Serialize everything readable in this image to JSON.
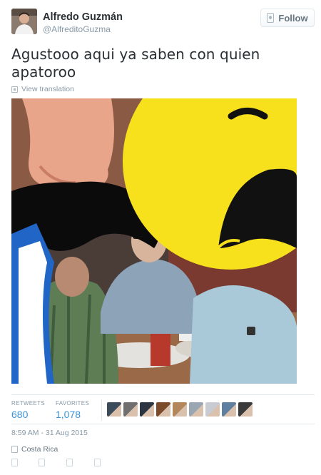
{
  "user": {
    "name": "Alfredo Guzmán",
    "handle": "@AlfreditoGuzma"
  },
  "follow": {
    "label": "Follow",
    "icon": "follow-user-icon"
  },
  "tweet": {
    "text": "Agustooo aqui ya saben con quien apatoroo",
    "translate_label": "View translation",
    "translate_icon": "translate-icon"
  },
  "stats": {
    "retweets_label": "RETWEETS",
    "retweets_value": "680",
    "favorites_label": "FAVORITES",
    "favorites_value": "1,078"
  },
  "favoriter_colors": [
    "#3d4a5a",
    "#6f6f6f",
    "#2c3440",
    "#7a4a2a",
    "#b3865b",
    "#9aa6b2",
    "#c8ccd2",
    "#5f7fa0",
    "#3a3a3a"
  ],
  "timestamp": "8:59 AM - 31 Aug 2015",
  "location": {
    "label": "Costa Rica",
    "icon": "location-pin-icon"
  },
  "actions": [
    "reply-icon",
    "retweet-icon",
    "favorite-icon",
    "more-icon"
  ],
  "colors": {
    "link": "#3b94d9",
    "meta": "#8899a6",
    "text": "#292f33",
    "emoji_yellow": "#f7e01c"
  }
}
